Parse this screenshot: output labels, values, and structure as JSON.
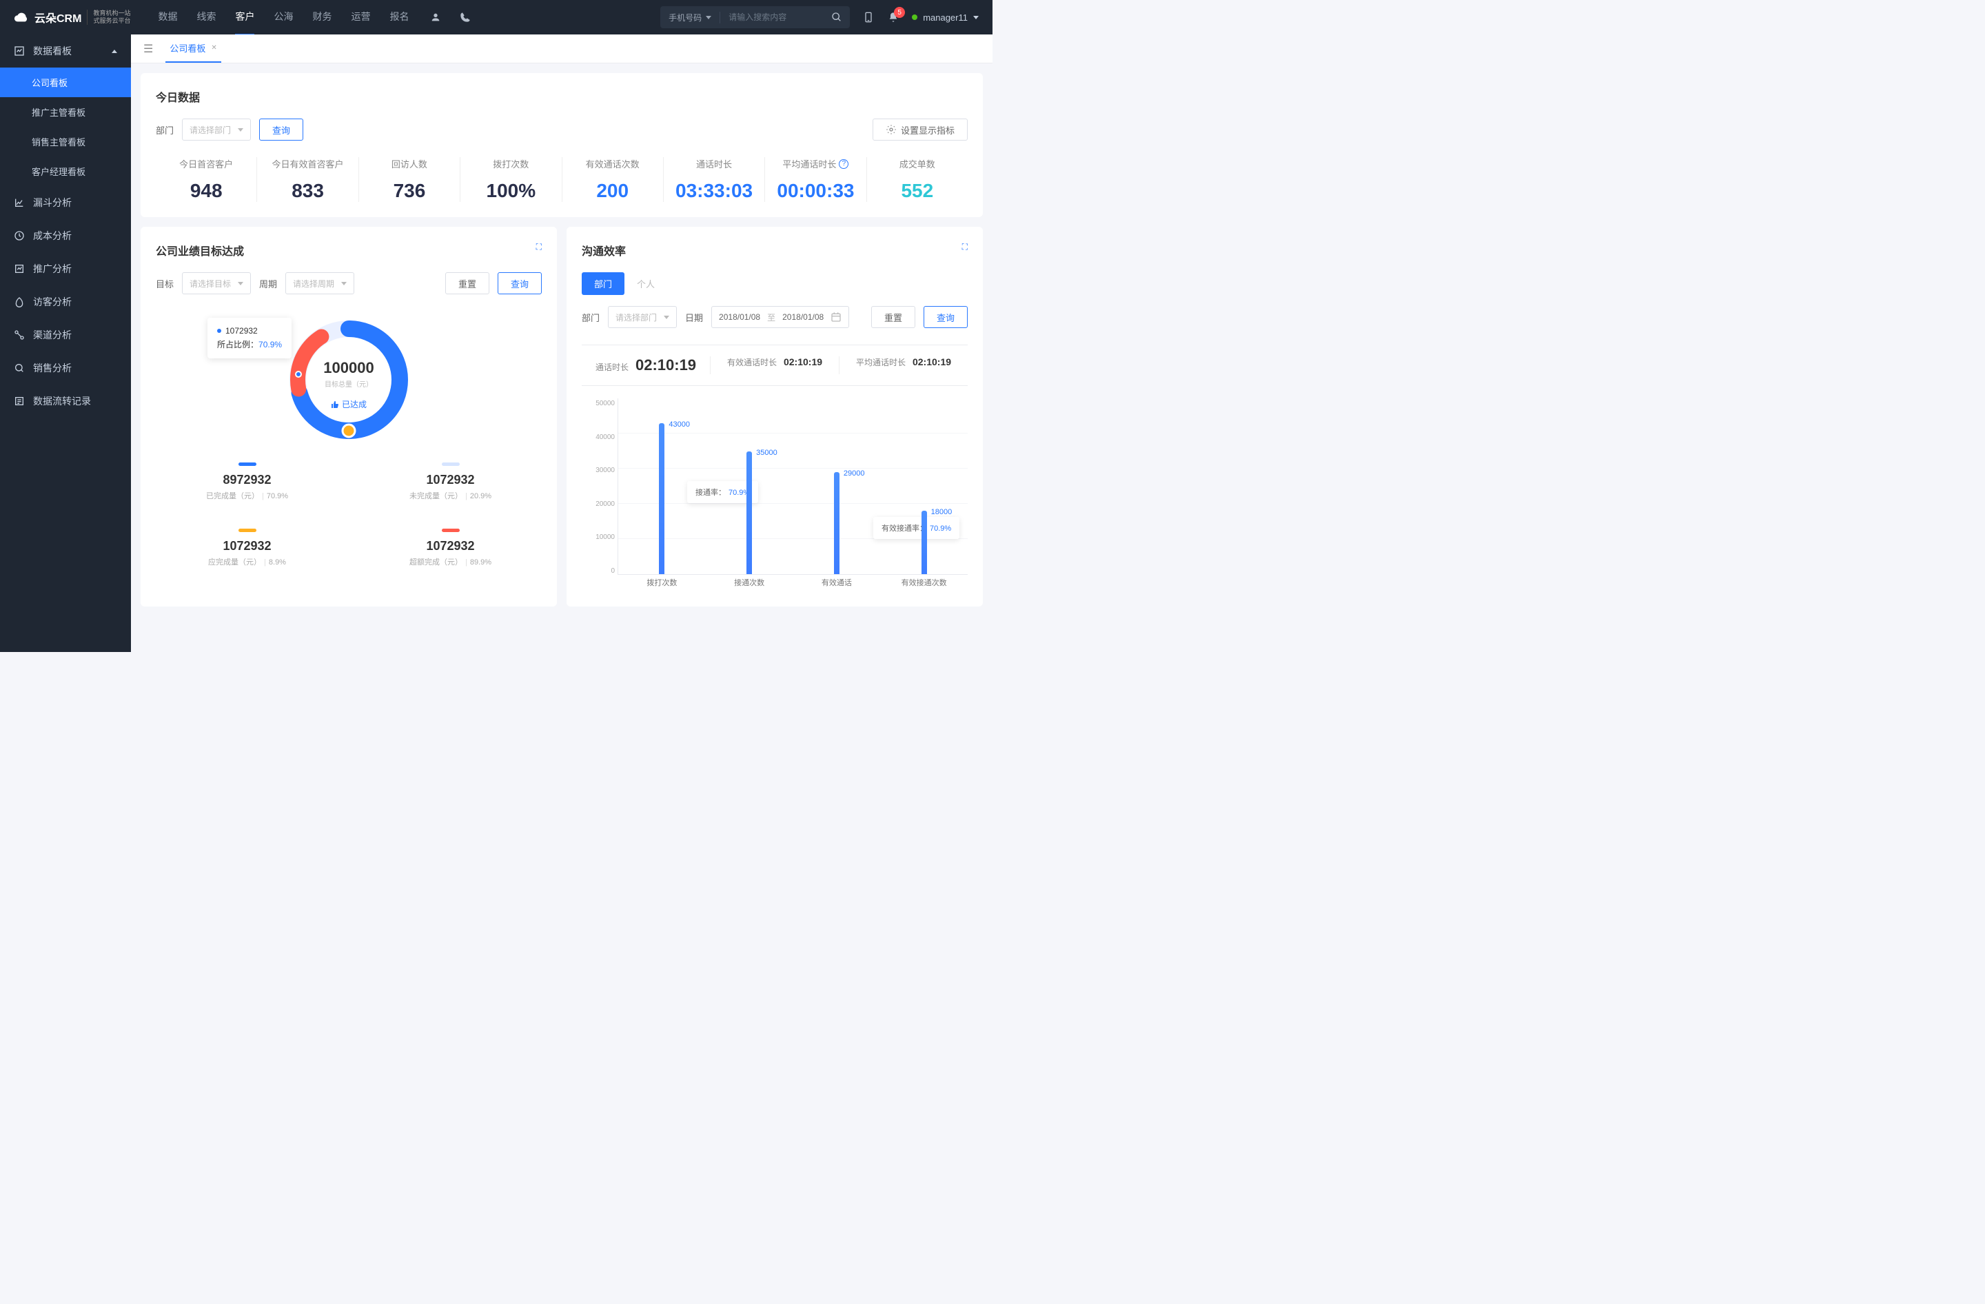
{
  "topbar": {
    "logo": "云朵CRM",
    "logo_sub1": "教育机构一站",
    "logo_sub2": "式服务云平台",
    "nav": [
      "数据",
      "线索",
      "客户",
      "公海",
      "财务",
      "运营",
      "报名"
    ],
    "nav_active": 2,
    "search_type": "手机号码",
    "search_placeholder": "请输入搜索内容",
    "notif_count": "5",
    "user": "manager11"
  },
  "sidebar": {
    "group": "数据看板",
    "children": [
      "公司看板",
      "推广主管看板",
      "销售主管看板",
      "客户经理看板"
    ],
    "child_active": 0,
    "items": [
      "漏斗分析",
      "成本分析",
      "推广分析",
      "访客分析",
      "渠道分析",
      "销售分析",
      "数据流转记录"
    ]
  },
  "tab": {
    "label": "公司看板"
  },
  "today": {
    "title": "今日数据",
    "dept_label": "部门",
    "dept_placeholder": "请选择部门",
    "query": "查询",
    "config": "设置显示指标",
    "stats": [
      {
        "label": "今日首咨客户",
        "value": "948",
        "cls": "c-navy"
      },
      {
        "label": "今日有效首咨客户",
        "value": "833",
        "cls": "c-navy"
      },
      {
        "label": "回访人数",
        "value": "736",
        "cls": "c-navy"
      },
      {
        "label": "拨打次数",
        "value": "100%",
        "cls": "c-navy"
      },
      {
        "label": "有效通话次数",
        "value": "200",
        "cls": "c-blue"
      },
      {
        "label": "通话时长",
        "value": "03:33:03",
        "cls": "c-blue"
      },
      {
        "label": "平均通话时长",
        "value": "00:00:33",
        "cls": "c-blue",
        "help": true
      },
      {
        "label": "成交单数",
        "value": "552",
        "cls": "c-cyan"
      }
    ]
  },
  "goal": {
    "title": "公司业绩目标达成",
    "target_label": "目标",
    "target_placeholder": "请选择目标",
    "period_label": "周期",
    "period_placeholder": "请选择周期",
    "reset": "重置",
    "query": "查询",
    "tooltip_val": "1072932",
    "tooltip_ratio_label": "所占比例：",
    "tooltip_ratio": "70.9%",
    "center_value": "100000",
    "center_sub": "目标总量（元）",
    "center_badge": "已达成",
    "progress": [
      {
        "num": "8972932",
        "label": "已完成量（元）",
        "pct": "70.9%",
        "bar": "pb-blue"
      },
      {
        "num": "1072932",
        "label": "未完成量（元）",
        "pct": "20.9%",
        "bar": "pb-gray"
      },
      {
        "num": "1072932",
        "label": "应完成量（元）",
        "pct": "8.9%",
        "bar": "pb-orange"
      },
      {
        "num": "1072932",
        "label": "超额完成（元）",
        "pct": "89.9%",
        "bar": "pb-red"
      }
    ]
  },
  "eff": {
    "title": "沟通效率",
    "seg": [
      "部门",
      "个人"
    ],
    "dept_label": "部门",
    "dept_placeholder": "请选择部门",
    "date_label": "日期",
    "date_from": "2018/01/08",
    "date_sep": "至",
    "date_to": "2018/01/08",
    "reset": "重置",
    "query": "查询",
    "stats": [
      {
        "l": "通话时长",
        "v": "02:10:19",
        "big": true
      },
      {
        "l": "有效通话时长",
        "v": "02:10:19"
      },
      {
        "l": "平均通话时长",
        "v": "02:10:19"
      }
    ],
    "float1": {
      "label": "接通率：",
      "val": "70.9%"
    },
    "float2": {
      "label": "有效接通率：",
      "val": "70.9%"
    }
  },
  "chart_data": {
    "type": "bar",
    "categories": [
      "拨打次数",
      "接通次数",
      "有效通话",
      "有效接通次数"
    ],
    "values": [
      43000,
      35000,
      29000,
      18000
    ],
    "labels": [
      "43000",
      "35000",
      "29000",
      "18000"
    ],
    "y_ticks": [
      "50000",
      "40000",
      "30000",
      "20000",
      "10000",
      "0"
    ],
    "ymax": 50000,
    "ylabel": "",
    "xlabel": ""
  }
}
